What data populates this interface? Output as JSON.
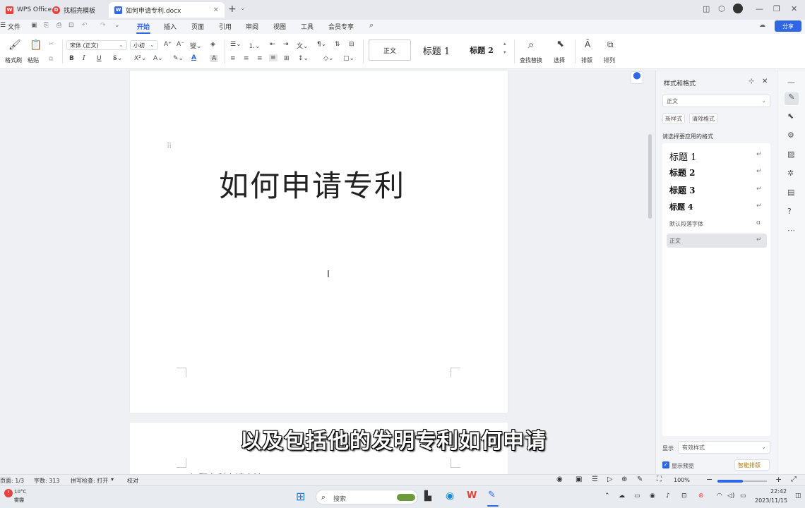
{
  "tabbar": {
    "tabs": [
      {
        "label": "WPS Office",
        "icon": "wps-logo-icon",
        "color": "#e8403a"
      },
      {
        "label": "找稻壳模板",
        "icon": "docer-icon",
        "color": "#e8403a"
      },
      {
        "label": "如何申请专利.docx",
        "icon": "word-doc-icon",
        "color": "#2f66e4"
      }
    ],
    "new_tab": "+",
    "new_tab_menu": "⌄"
  },
  "menubar": {
    "file": "文件",
    "items": [
      "开始",
      "插入",
      "页面",
      "引用",
      "审阅",
      "视图",
      "工具",
      "会员专享"
    ],
    "active": "开始",
    "share": "分享"
  },
  "ribbon": {
    "format_painter": "格式刷",
    "paste": "粘贴",
    "font_name": "宋体 (正文)",
    "font_size": "小初",
    "bold": "B",
    "italic": "I",
    "underline": "U",
    "styles": [
      "正文",
      "标题 1",
      "标题 2"
    ],
    "find_replace": "查找替换",
    "select": "选择",
    "typesetting": "排版",
    "arrange": "排列"
  },
  "document": {
    "title": "如何申请专利",
    "page2_text": "标题专利申请方法"
  },
  "subtitle": "以及包括他的发明专利如何申请",
  "style_panel": {
    "header": "样式和格式",
    "current_style": "正文",
    "new_style": "新样式",
    "clear_format": "清除格式",
    "choose_label": "请选择要应用的格式",
    "items": [
      "标题 1",
      "标题 2",
      "标题 3",
      "标题 4",
      "默认段落字体",
      "正文"
    ],
    "show_label": "显示",
    "show_value": "有效样式",
    "show_preview": "显示预览",
    "smart_layout": "智能排版"
  },
  "statusbar": {
    "page": "页面: 1/3",
    "words": "字数: 313",
    "spellcheck": "拼写检查: 打开",
    "proof": "校对",
    "zoom": "100%"
  },
  "taskbar": {
    "weather_temp": "10°C",
    "weather_text": "雾霾",
    "search": "搜索",
    "time": "22:42",
    "date": "2023/11/15"
  },
  "colors": {
    "accent": "#2f66e4",
    "wps_red": "#e8403a"
  }
}
